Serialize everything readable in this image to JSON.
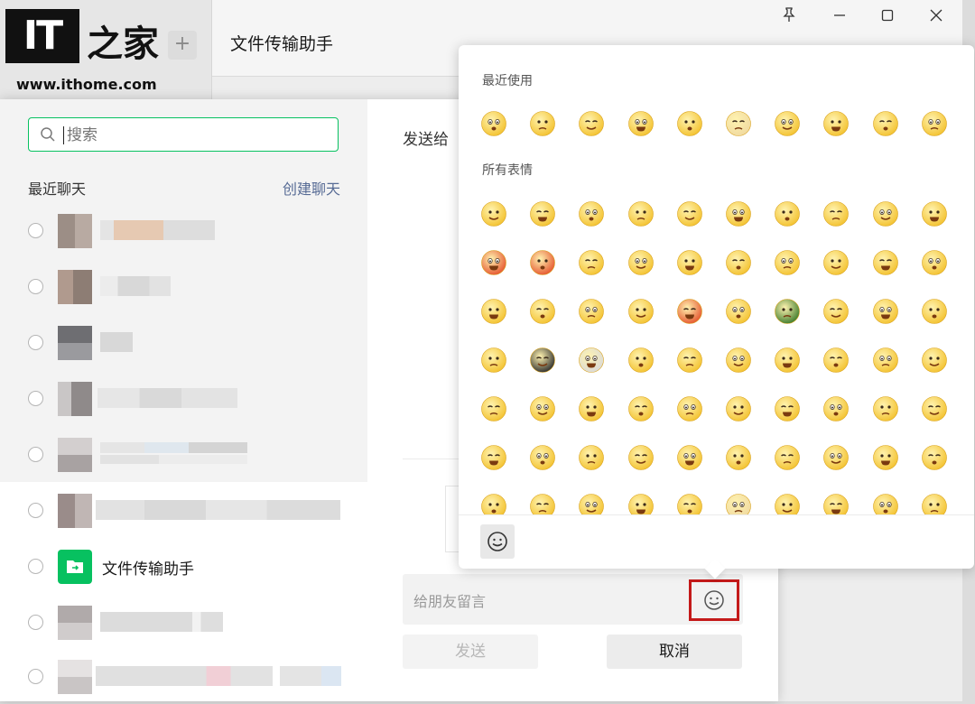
{
  "watermark": {
    "logo_text": "IT之家",
    "url": "www.ithome.com"
  },
  "main_window": {
    "plus_label": "+",
    "chat_title": "文件传输助手",
    "controls": {
      "pin": "⊥",
      "minimize": "—",
      "maximize": "☐",
      "close": "✕"
    }
  },
  "share_dialog": {
    "search_placeholder": "搜索",
    "recent_label": "最近聊天",
    "create_chat": "创建聊天",
    "send_to_label": "发送给",
    "file_helper_name": "文件传输助手",
    "message_placeholder": "给朋友留言",
    "send_button": "发送",
    "cancel_button": "取消"
  },
  "emoji_panel": {
    "recent_title": "最近使用",
    "all_title": "所有表情"
  },
  "colors": {
    "wechat_green": "#07c160",
    "link_blue": "#576b95",
    "highlight_red": "#c41a1a"
  }
}
